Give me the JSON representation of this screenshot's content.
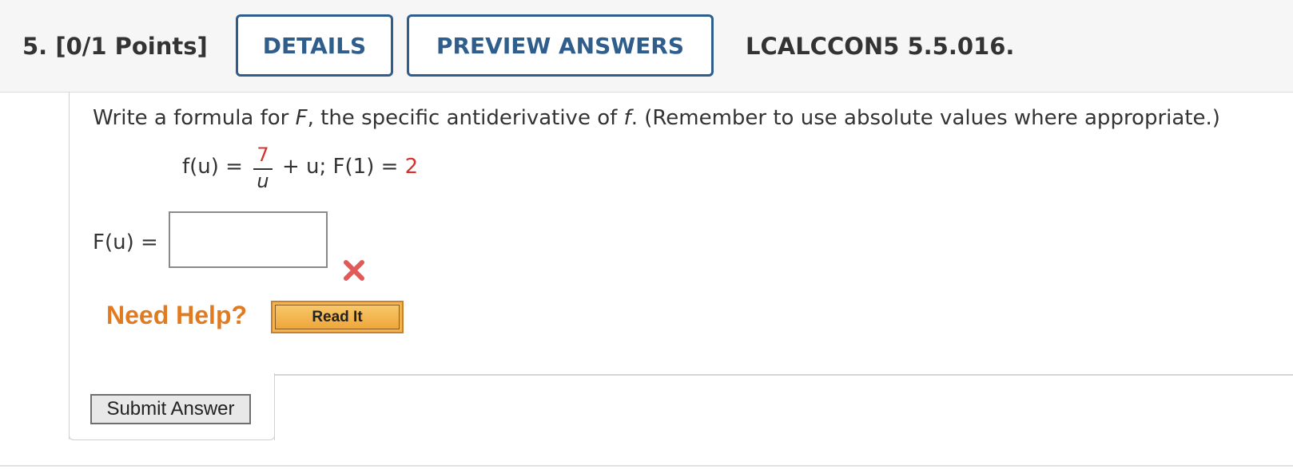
{
  "header": {
    "question_number": "5.",
    "points": "[0/1 Points]",
    "details_label": "DETAILS",
    "previous_answers_label": "PREVIEW ANSWERS",
    "problem_code": "LCALCCON5 5.5.016."
  },
  "question": {
    "prompt_part1": "Write a formula for ",
    "prompt_F": "F",
    "prompt_part2": ", the specific antiderivative of ",
    "prompt_f": "f",
    "prompt_part3": ". (Remember to use absolute values where appropriate.)",
    "formula_lhs": "f(u) =",
    "fraction_numerator": "7",
    "fraction_denominator": "u",
    "formula_rhs": " + u; F(1) = ",
    "formula_value": "2"
  },
  "answer": {
    "label": "F(u) =",
    "value": "",
    "status": "incorrect",
    "status_icon": "x-mark-icon",
    "status_color": "#e05a5a"
  },
  "help": {
    "need_help_label": "Need Help?",
    "read_it_label": "Read It"
  },
  "actions": {
    "submit_label": "Submit Answer"
  },
  "colors": {
    "accent_blue": "#2f5d8c",
    "highlight_red": "#d9302a",
    "help_orange": "#e07b22",
    "read_it_gold": "#f2b44f"
  }
}
